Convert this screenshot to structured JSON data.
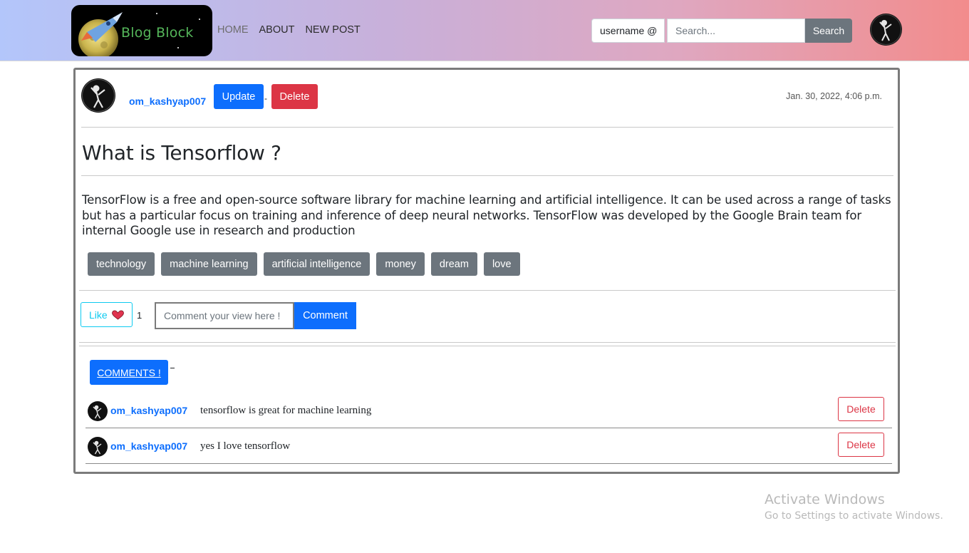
{
  "navbar": {
    "logo_text": "Blog Block",
    "links": [
      {
        "label": "HOME",
        "muted": true
      },
      {
        "label": "ABOUT",
        "muted": false
      },
      {
        "label": "NEW POST",
        "muted": false
      }
    ],
    "username_prefix": "username @",
    "search_placeholder": "Search...",
    "search_button": "Search",
    "avatar_icon": "dabbing-skeleton-avatar"
  },
  "post": {
    "author": "om_kashyap007",
    "update_label": "Update",
    "separator": "-",
    "delete_label": "Delete",
    "date": "Jan. 30, 2022, 4:06 p.m.",
    "title": "What is Tensorflow ?",
    "body": "TensorFlow is a free and open-source software library for machine learning and artificial intelligence. It can be used across a range of tasks but has a particular focus on training and inference of deep neural networks. TensorFlow was developed by the Google Brain team for internal Google use in research and production",
    "tags": [
      "technology",
      "machine learning",
      "artificial intelligence",
      "money",
      "dream",
      "love"
    ],
    "like_label": "Like",
    "like_icon": "heart-icon",
    "like_count": "1",
    "comment_placeholder": "Comment your view here !",
    "comment_button": "Comment"
  },
  "comments": {
    "toggle_label": "COMMENTS !",
    "items": [
      {
        "user": "om_kashyap007",
        "text": "tensorflow is great for machine learning",
        "delete_label": "Delete"
      },
      {
        "user": "om_kashyap007",
        "text": "yes I love tensorflow",
        "delete_label": "Delete"
      }
    ]
  },
  "watermark": {
    "title": "Activate Windows",
    "subtitle": "Go to Settings to activate Windows."
  },
  "colors": {
    "primary": "#0d6efd",
    "danger": "#dc3545",
    "secondary": "#6c757d",
    "info": "#0dcaf0"
  }
}
